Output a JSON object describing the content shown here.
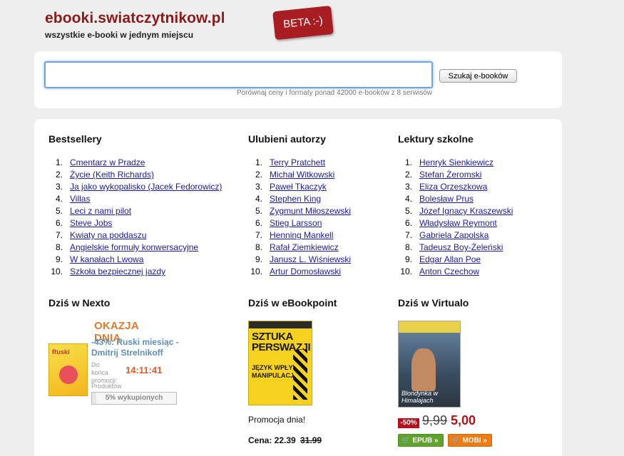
{
  "header": {
    "title": "ebooki.swiatczytnikow.pl",
    "tagline": "wszystkie e-booki w jednym miejscu",
    "beta": "BETA :-)"
  },
  "search": {
    "value": "",
    "button": "Szukaj e-booków",
    "hint": "Porównaj ceny i formaty ponad 42000 e-booków z 8 serwisów"
  },
  "bestsellers": {
    "heading": "Bestsellery",
    "items": [
      {
        "n": "1.",
        "label": "Cmentarz w Pradze"
      },
      {
        "n": "2.",
        "label": "Życie (Keith Richards)"
      },
      {
        "n": "3.",
        "label": "Ja jako wykopalisko (Jacek Fedorowicz)"
      },
      {
        "n": "4.",
        "label": "Villas"
      },
      {
        "n": "5.",
        "label": "Leci z nami pilot"
      },
      {
        "n": "6.",
        "label": "Steve Jobs"
      },
      {
        "n": "7.",
        "label": "Kwiaty na poddaszu"
      },
      {
        "n": "8.",
        "label": "Angielskie formuły konwersacyjne"
      },
      {
        "n": "9.",
        "label": "W kanałach Lwowa"
      },
      {
        "n": "10.",
        "label": "Szkoła bezpiecznej jazdy"
      }
    ]
  },
  "authors": {
    "heading": "Ulubieni autorzy",
    "items": [
      {
        "n": "1.",
        "label": "Terry Pratchett"
      },
      {
        "n": "2.",
        "label": "Michał Witkowski"
      },
      {
        "n": "3.",
        "label": "Paweł Tkaczyk"
      },
      {
        "n": "4.",
        "label": "Stephen King"
      },
      {
        "n": "5.",
        "label": "Zygmunt Miłoszewski"
      },
      {
        "n": "6.",
        "label": "Stieg Larsson"
      },
      {
        "n": "7.",
        "label": "Henning Mankell"
      },
      {
        "n": "8.",
        "label": "Rafał Ziemkiewicz"
      },
      {
        "n": "9.",
        "label": "Janusz L. Wiśniewski"
      },
      {
        "n": "10.",
        "label": "Artur Domosławski"
      }
    ]
  },
  "school": {
    "heading": "Lektury szkolne",
    "items": [
      {
        "n": "1.",
        "label": "Henryk Sienkiewicz"
      },
      {
        "n": "2.",
        "label": "Stefan Żeromski"
      },
      {
        "n": "3.",
        "label": "Eliza Orzeszkowa"
      },
      {
        "n": "4.",
        "label": "Bolesław Prus"
      },
      {
        "n": "5.",
        "label": "Józef Ignacy Kraszewski"
      },
      {
        "n": "6.",
        "label": "Władysław Reymont"
      },
      {
        "n": "7.",
        "label": "Gabriela Zapolska"
      },
      {
        "n": "8.",
        "label": "Tadeusz Boy-Żeleński"
      },
      {
        "n": "9.",
        "label": "Edgar Allan Poe"
      },
      {
        "n": "10.",
        "label": "Anton Czechow"
      }
    ]
  },
  "nexto": {
    "heading": "Dziś w Nexto",
    "okazja": "OKAZJA DNIA",
    "title": "-43%: Ruski miesiąc - Dmitrij Strelnikoff",
    "cover_text": "Ruski",
    "ends_label_1": "Do końca",
    "ends_label_2": "promocji:",
    "timer": "14:11:41",
    "sold_label": "Produktów w promocji:",
    "sold_text": "5% wykupionych",
    "sold_fraction": 0.05
  },
  "ebookpoint": {
    "heading": "Dziś w eBookpoint",
    "cover_title_1": "SZTUKA",
    "cover_title_2": "PERSWAZJI",
    "cover_sub": "JĘZYK WPŁYWU I MANIPULACJI",
    "promo": "Promocja dnia!",
    "price_label": "Cena: 22.39",
    "old_price": "31.99"
  },
  "virtualo": {
    "heading": "Dziś w Virtualo",
    "cover_title": "Blondynka w Himalajach",
    "discount": "-50%",
    "old_price": "9,99",
    "new_price": "5,00",
    "epub": "EPUB »",
    "mobi": "MOBI »"
  },
  "colors": {
    "title": "#8b1a1a",
    "link": "#1a1aa6",
    "accent_orange": "#e07a2c",
    "price_red": "#b8101a",
    "epub_green": "#5fa32c",
    "mobi_orange": "#ee7b14"
  }
}
